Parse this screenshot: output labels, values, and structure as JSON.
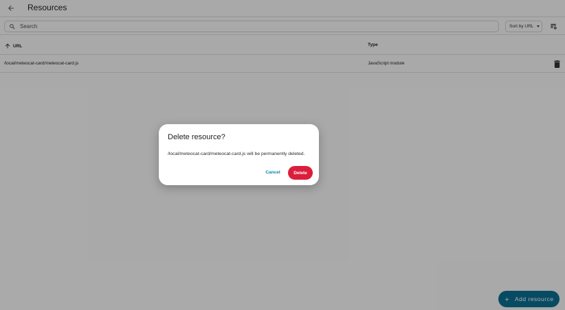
{
  "header": {
    "title": "Resources",
    "back_icon": "arrow-left-icon"
  },
  "toolbar": {
    "search_placeholder": "Search",
    "sort_label": "Sort by URL",
    "settings_icon": "table-settings-icon"
  },
  "table": {
    "columns": [
      "URL",
      "Type"
    ],
    "sort_icon": "arrow-up-icon",
    "rows": [
      {
        "url": "/local/meteocat-card/meteocat-card.js",
        "type": "JavaScript module"
      }
    ]
  },
  "fab": {
    "label": "Add resource",
    "icon": "plus-icon"
  },
  "dialog": {
    "title": "Delete resource?",
    "message": "/local/meteocat-card/meteocat-card.js will be permanently deleted.",
    "cancel_label": "Cancel",
    "delete_label": "Delete"
  },
  "colors": {
    "accent": "#0b7fb5",
    "fab": "#0b6f93",
    "danger": "#db1e3c",
    "scrim": "rgba(0,0,0,0.32)"
  }
}
